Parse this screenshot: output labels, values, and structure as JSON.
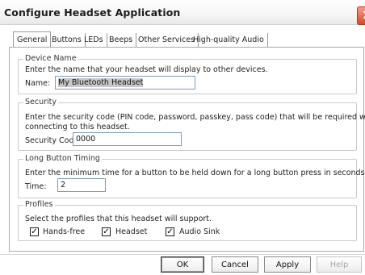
{
  "window": {
    "title": "Configure Headset Application",
    "close_glyph": "X"
  },
  "tabs": [
    {
      "label": "General"
    },
    {
      "label": "Buttons"
    },
    {
      "label": "LEDs"
    },
    {
      "label": "Beeps"
    },
    {
      "label": "Other Services"
    },
    {
      "label": "High-quality Audio"
    }
  ],
  "device_name": {
    "title": "Device Name",
    "description": "Enter the name that your headset will display to other devices.",
    "label": "Name:",
    "value": "My Bluetooth Headset"
  },
  "security": {
    "title": "Security",
    "description_line1": "Enter the security code (PIN code, password, passkey, pass code) that will be required when",
    "description_line2": "connecting to this headset.",
    "label": "Security Code:",
    "value": "0000"
  },
  "long_button": {
    "title": "Long Button Timing",
    "description": "Enter the minimum time for a button to be held down for a long button press in seconds.",
    "label": "Time:",
    "value": "2"
  },
  "profiles": {
    "title": "Profiles",
    "description": "Select the profiles that this headset will support.",
    "items": [
      {
        "label": "Hands-free",
        "checked": true
      },
      {
        "label": "Headset",
        "checked": true
      },
      {
        "label": "Audio Sink",
        "checked": true
      }
    ],
    "check_glyph": "✓"
  },
  "buttons": {
    "ok": "OK",
    "cancel": "Cancel",
    "apply": "Apply",
    "help": "Help"
  }
}
